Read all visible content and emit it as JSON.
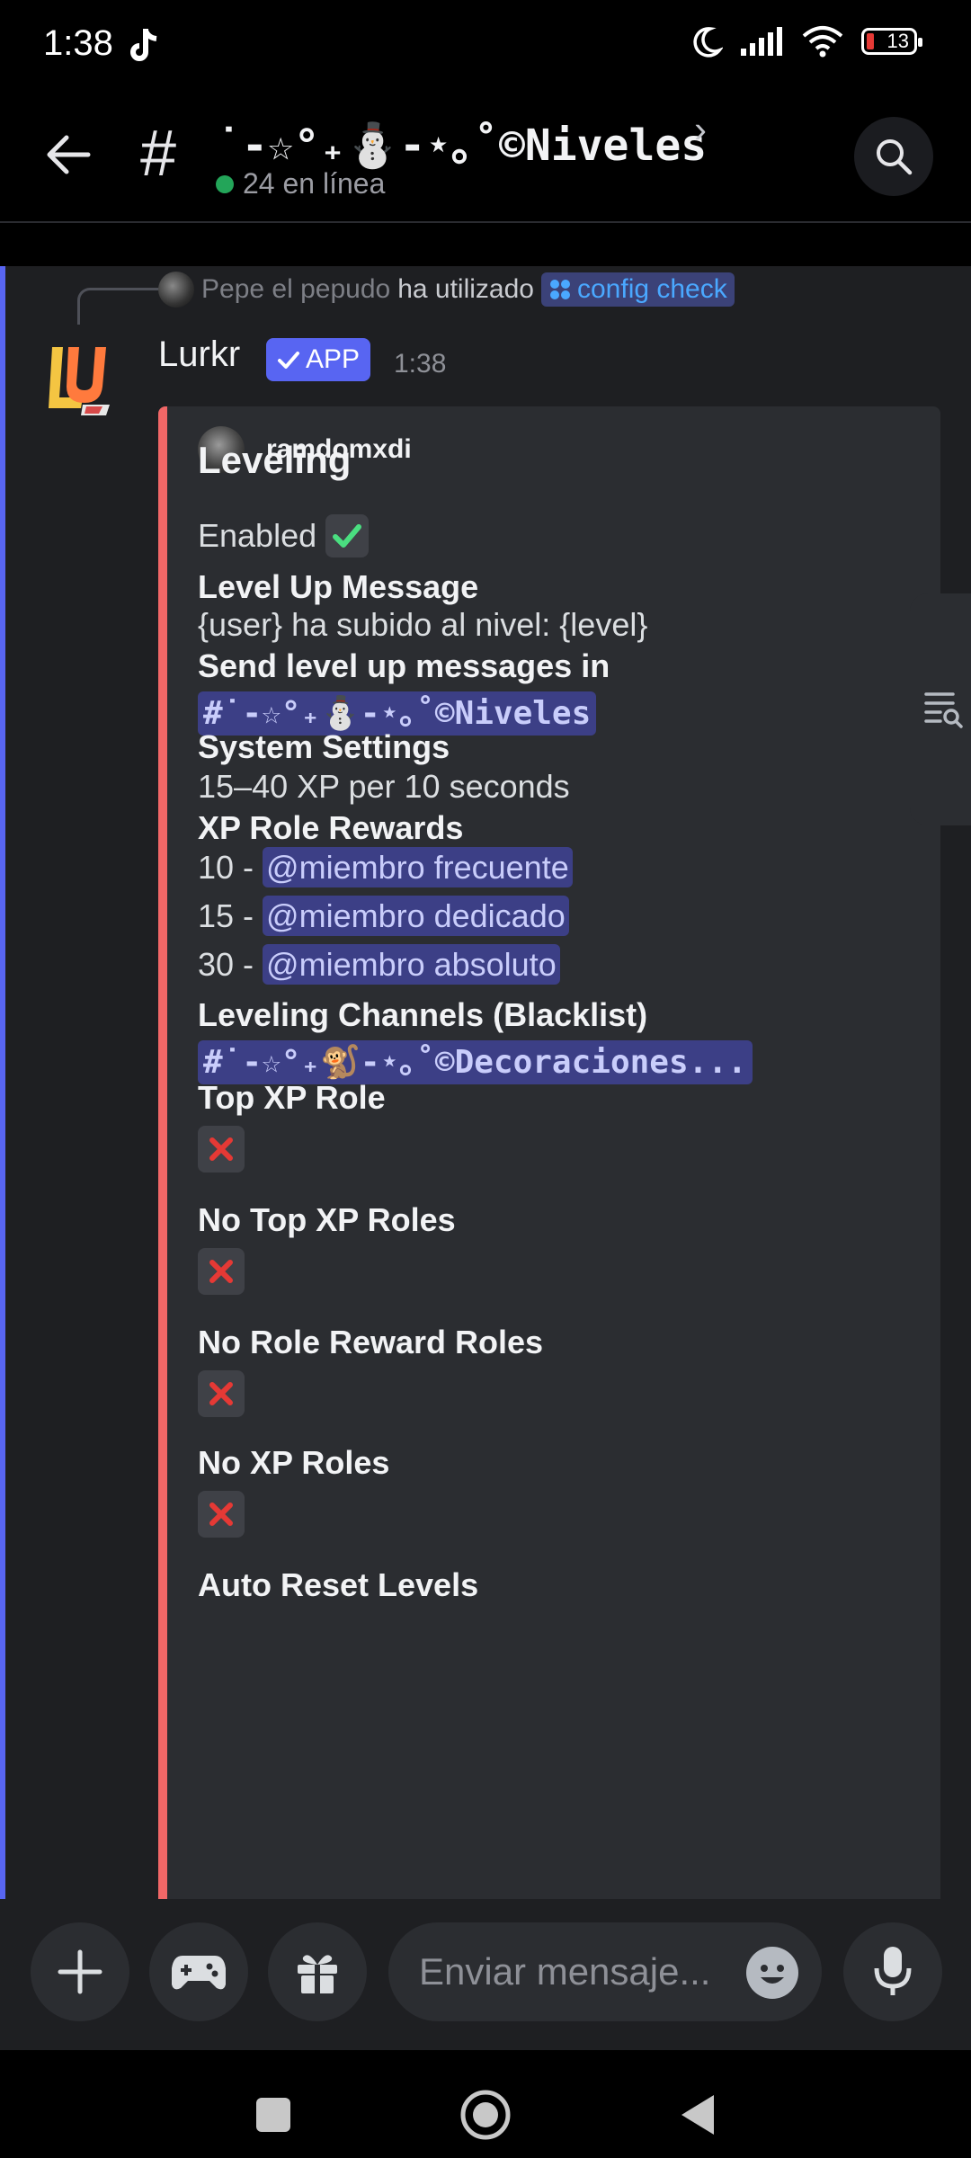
{
  "status_bar": {
    "time": "1:38",
    "battery": "13"
  },
  "header": {
    "channel_hash": "#",
    "channel_name": "˙-☆°₊⛄-⋆｡˚©Niveles",
    "chevron": "›",
    "online_count": "24 en línea"
  },
  "reply": {
    "username": "Pepe el pepudo",
    "action": "ha utilizado",
    "command": "config check"
  },
  "message": {
    "author": "Lurkr",
    "badge": "APP",
    "time": "1:38",
    "embed": {
      "author_name": "ramdomxdi",
      "title": "Leveling",
      "enabled_label": "Enabled",
      "fields": {
        "level_up_message_name": "Level Up Message",
        "level_up_message_value": "{user} ha subido al nivel: {level}",
        "send_in_name": "Send level up messages in",
        "send_in_channel": "#˙-☆°₊⛄-⋆｡˚©Niveles",
        "system_settings_name": "System Settings",
        "system_settings_value": "15–40 XP per 10 seconds",
        "role_rewards_name": "XP Role Rewards",
        "role_rewards": [
          {
            "level": "10 - ",
            "role": "@miembro frecuente"
          },
          {
            "level": "15 - ",
            "role": "@miembro dedicado"
          },
          {
            "level": "30 - ",
            "role": "@miembro absoluto"
          }
        ],
        "blacklist_name": "Leveling Channels (Blacklist)",
        "blacklist_channel": "#˙-☆°₊🐒-⋆｡˚©Decoraciones...",
        "top_xp_role_name": "Top XP Role",
        "no_top_xp_roles_name": "No Top XP Roles",
        "no_role_reward_roles_name": "No Role Reward Roles",
        "no_xp_roles_name": "No XP Roles",
        "auto_reset_levels_name": "Auto Reset Levels"
      }
    }
  },
  "composer": {
    "placeholder": "Enviar mensaje..."
  },
  "colors": {
    "embed_bar": "#f16767",
    "app_badge": "#5865f2",
    "online": "#23a559",
    "check": "#4ade80",
    "cross": "#e53935"
  },
  "icons": {
    "back": "arrow-left-icon",
    "search": "search-icon",
    "add": "plus-icon",
    "games": "gamepad-icon",
    "gift": "gift-icon",
    "emoji": "emoji-icon",
    "mic": "microphone-icon",
    "nav_recents": "square-icon",
    "nav_home": "circle-icon",
    "nav_back": "triangle-back-icon"
  }
}
